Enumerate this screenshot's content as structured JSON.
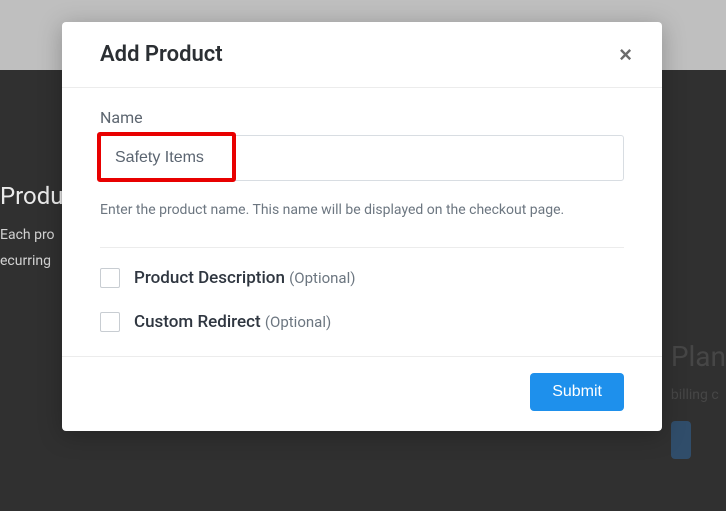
{
  "background": {
    "section_title": "Produ",
    "section_subtitle_line1": "Each pro",
    "section_subtitle_line2": "ecurring",
    "plan_title": "Plan",
    "plan_sub": "billing c"
  },
  "modal": {
    "title": "Add Product",
    "name_label": "Name",
    "name_value": "Safety Items",
    "name_helper": "Enter the product name. This name will be displayed on the checkout page.",
    "option_description_label": "Product Description",
    "option_description_optional": "(Optional)",
    "option_redirect_label": "Custom Redirect",
    "option_redirect_optional": "(Optional)",
    "submit_label": "Submit"
  }
}
